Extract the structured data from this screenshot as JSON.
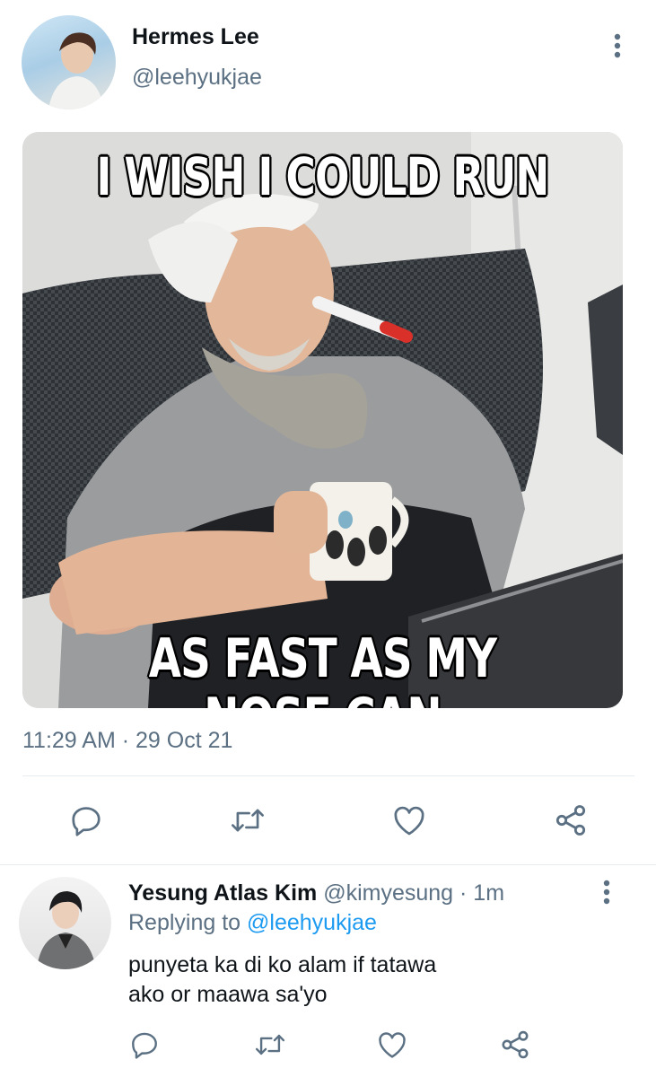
{
  "tweet": {
    "author_name": "Hermes Lee",
    "author_handle": "@leehyukjae",
    "meme_top_text": "I WISH I COULD RUN",
    "meme_bottom_text": "AS FAST AS MY NOSE CAN",
    "timestamp": "11:29 AM · 29 Oct 21",
    "actions": [
      "reply-icon",
      "retweet-icon",
      "like-icon",
      "share-icon"
    ]
  },
  "reply": {
    "author_name": "Yesung Atlas Kim",
    "author_handle": "@kimyesung",
    "time": "· 1m",
    "replying_label": "Replying to",
    "replying_handle": "@leehyukjae",
    "text": "punyeta ka di ko alam if tatawa ako or maawa sa'yo",
    "actions": [
      "reply-icon",
      "retweet-icon",
      "like-icon",
      "share-icon"
    ]
  },
  "colors": {
    "icon": "#5b7083",
    "link": "#1d9bf0",
    "divider": "#e6ecf0"
  }
}
